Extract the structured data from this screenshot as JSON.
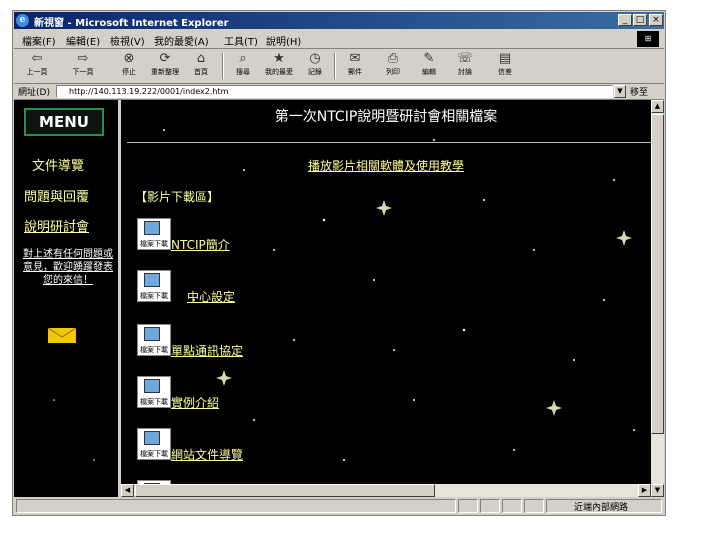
{
  "window": {
    "title": "新視窗 - Microsoft Internet Explorer",
    "controls": {
      "minimize": "_",
      "maximize": "□",
      "close": "×"
    }
  },
  "menubar": {
    "items": [
      "檔案(F)",
      "編輯(E)",
      "檢視(V)",
      "我的最愛(A)",
      "工具(T)",
      "說明(H)"
    ]
  },
  "toolbar": {
    "buttons": [
      {
        "icon": "back-arrow-icon",
        "glyph": "⇦",
        "label": "上一頁"
      },
      {
        "icon": "forward-arrow-icon",
        "glyph": "⇨",
        "label": "下一頁"
      },
      {
        "icon": "stop-icon",
        "glyph": "⊗",
        "label": "停止"
      },
      {
        "icon": "refresh-icon",
        "glyph": "⟳",
        "label": "重新整理"
      },
      {
        "icon": "home-icon",
        "glyph": "⌂",
        "label": "首頁"
      },
      {
        "icon": "search-icon",
        "glyph": "⌕",
        "label": "搜尋"
      },
      {
        "icon": "favorites-icon",
        "glyph": "★",
        "label": "我的最愛"
      },
      {
        "icon": "history-icon",
        "glyph": "◷",
        "label": "記錄"
      },
      {
        "icon": "mail-icon",
        "glyph": "✉",
        "label": "郵件"
      },
      {
        "icon": "print-icon",
        "glyph": "⎙",
        "label": "列印"
      },
      {
        "icon": "edit-icon",
        "glyph": "✎",
        "label": "編輯"
      },
      {
        "icon": "discuss-icon",
        "glyph": "☏",
        "label": "討論"
      },
      {
        "icon": "messenger-icon",
        "glyph": "▤",
        "label": "信差"
      }
    ]
  },
  "address": {
    "label": "網址(D)",
    "value": "http://140.113.19.222/0001/index2.htm",
    "go_label": "移至"
  },
  "left_frame": {
    "menu_label": "MENU",
    "nav_items": [
      "文件導覽",
      "問題與回覆",
      "說明研討會"
    ],
    "message": "對上述有任何問題或意見，歡迎踴躍發表您的來信！"
  },
  "main_frame": {
    "title": "第一次NTCIP說明暨研討會相關檔案",
    "play_link": "播放影片相關軟體及使用教學",
    "section_title": "【影片下載區】",
    "download_caption": "檔案下載",
    "items": [
      "NTCIP簡介",
      "中心設定",
      "單點通訊協定",
      "實例介紹",
      "網站文件導覽"
    ]
  },
  "status": {
    "zone": "近端內部網路"
  }
}
